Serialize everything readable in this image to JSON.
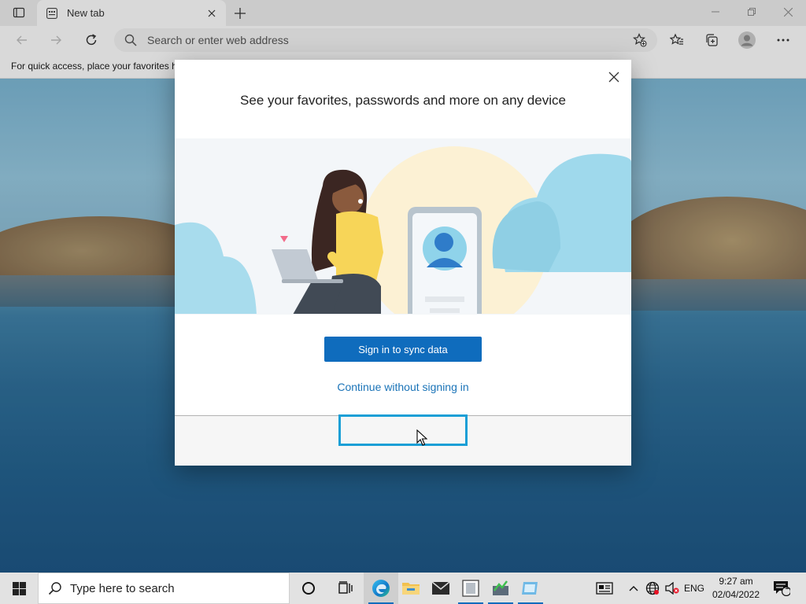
{
  "browser": {
    "tab": {
      "title": "New tab"
    },
    "address_bar": {
      "placeholder": "Search or enter web address"
    },
    "favorites_bar": {
      "text": "For quick access, place your favorites h"
    }
  },
  "dialog": {
    "title": "See your favorites, passwords and more on any device",
    "primary_button": "Sign in to sync data",
    "secondary_link": "Continue without signing in"
  },
  "taskbar": {
    "search_placeholder": "Type here to search",
    "language": "ENG",
    "time": "9:27 am",
    "date": "02/04/2022",
    "notification_count": "1"
  },
  "colors": {
    "accent": "#0f6cbd",
    "link": "#1b74b8",
    "focus_ring": "#1a9fd6"
  }
}
